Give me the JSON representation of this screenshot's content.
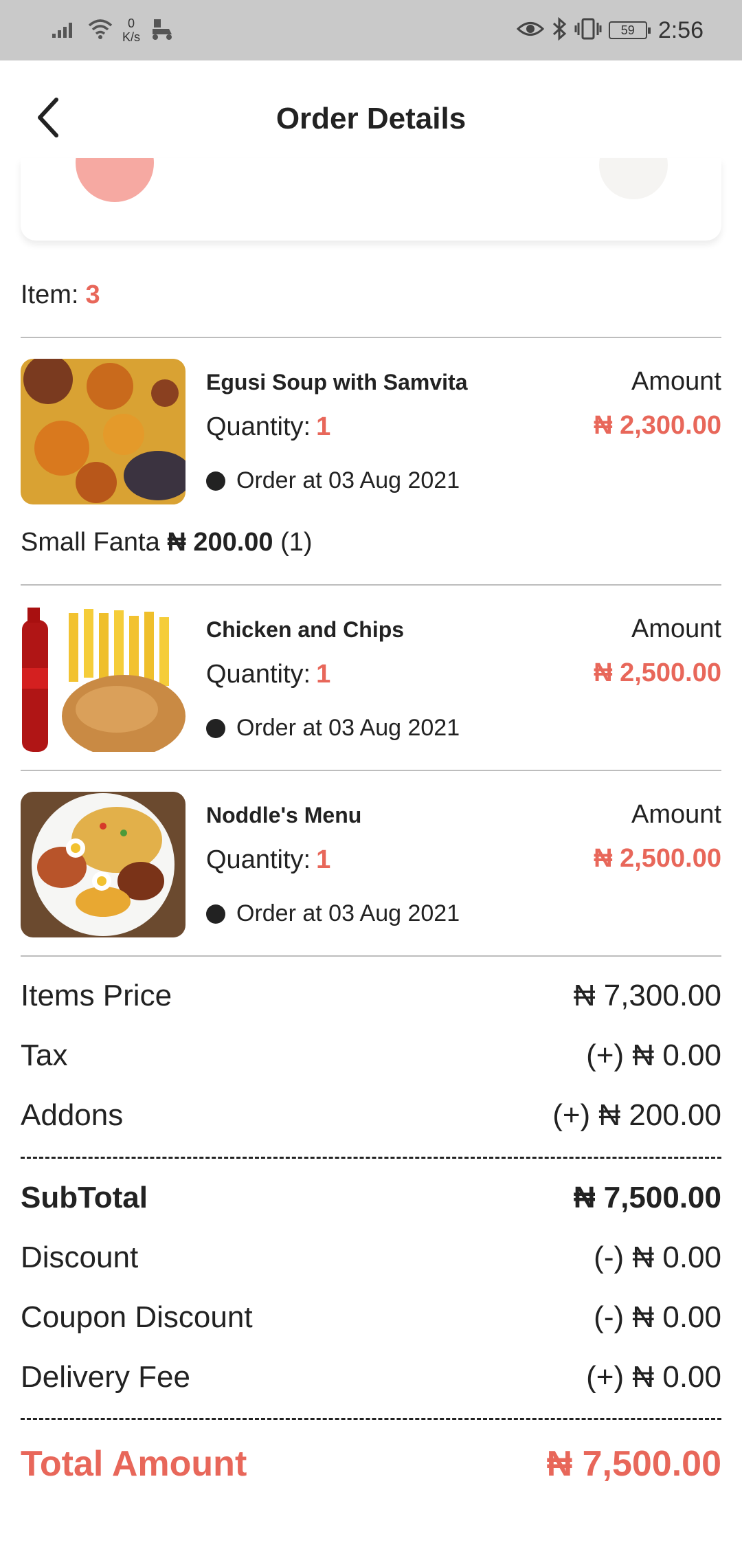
{
  "status_bar": {
    "speed_value": "0",
    "speed_unit": "K/s",
    "battery": "59",
    "time": "2:56"
  },
  "header": {
    "title": "Order Details"
  },
  "items_summary": {
    "label": "Item:",
    "count": "3"
  },
  "order_items": [
    {
      "name": "Egusi Soup with Samvita",
      "quantity_label": "Quantity:",
      "quantity": "1",
      "order_date": "Order at 03 Aug 2021",
      "amount_label": "Amount",
      "amount": "₦ 2,300.00",
      "image": "egusi-soup-image"
    },
    {
      "name": "Chicken and Chips",
      "quantity_label": "Quantity:",
      "quantity": "1",
      "order_date": "Order at 03 Aug 2021",
      "amount_label": "Amount",
      "amount": "₦ 2,500.00",
      "image": "chicken-chips-image"
    },
    {
      "name": "Noddle's Menu",
      "quantity_label": "Quantity:",
      "quantity": "1",
      "order_date": "Order at 03 Aug 2021",
      "amount_label": "Amount",
      "amount": "₦ 2,500.00",
      "image": "noodles-plate-image"
    }
  ],
  "addon": {
    "name": "Small Fanta",
    "price": "₦ 200.00",
    "count": "(1)"
  },
  "summary": {
    "items_price": {
      "label": "Items Price",
      "value": "₦ 7,300.00"
    },
    "tax": {
      "label": "Tax",
      "value": "(+) ₦ 0.00"
    },
    "addons": {
      "label": "Addons",
      "value": "(+) ₦ 200.00"
    },
    "subtotal": {
      "label": "SubTotal",
      "value": "₦ 7,500.00"
    },
    "discount": {
      "label": "Discount",
      "value": "(-) ₦ 0.00"
    },
    "coupon_discount": {
      "label": "Coupon Discount",
      "value": "(-) ₦ 0.00"
    },
    "delivery_fee": {
      "label": "Delivery Fee",
      "value": "(+) ₦ 0.00"
    },
    "total": {
      "label": "Total Amount",
      "value": "₦ 7,500.00"
    }
  },
  "colors": {
    "accent": "#e8675a",
    "status_bar": "#c9c9c9",
    "text": "#222222"
  }
}
